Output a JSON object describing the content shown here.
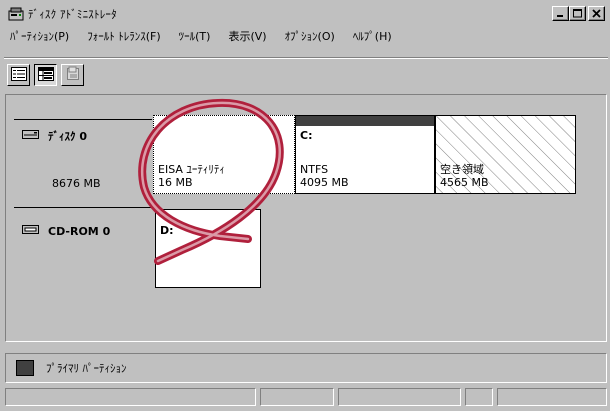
{
  "window": {
    "title": "ﾃﾞｨｽｸ ｱﾄﾞﾐﾆｽﾄﾚｰﾀ",
    "controls": [
      "_",
      "□",
      "×"
    ]
  },
  "menu": [
    "ﾊﾟｰﾃｨｼｮﾝ(P)",
    "ﾌｫｰﾙﾄ ﾄﾚﾗﾝｽ(F)",
    "ﾂｰﾙ(T)",
    "表示(V)",
    "ｵﾌﾟｼｮﾝ(O)",
    "ﾍﾙﾌﾟ(H)"
  ],
  "toolbar": [
    {
      "icon": "list-view-icon"
    },
    {
      "icon": "disk-view-icon",
      "pressed": true
    },
    {
      "icon": "properties-icon"
    }
  ],
  "disks": [
    {
      "label": "ﾃﾞｨｽｸ 0",
      "size": "8676 MB",
      "icon": "hard-disk-icon",
      "partitions": [
        {
          "drive": "",
          "fs": "EISA ﾕｰﾃｨﾘﾃｨ",
          "size": "16 MB",
          "kind": "eisa"
        },
        {
          "drive": "C:",
          "fs": "NTFS",
          "size": "4095 MB",
          "kind": "primary"
        },
        {
          "drive": "",
          "fs": "空き領域",
          "size": "4565 MB",
          "kind": "free"
        }
      ]
    },
    {
      "label": "CD-ROM 0",
      "icon": "cdrom-icon",
      "partitions": [
        {
          "drive": "D:",
          "kind": "cdrom"
        }
      ]
    }
  ],
  "legend": {
    "label": "ﾌﾟﾗｲﾏﾘ ﾊﾟｰﾃｨｼｮﾝ",
    "color": "#404040"
  },
  "annotation": {
    "type": "loop-arrow",
    "color": "#b0203c"
  }
}
